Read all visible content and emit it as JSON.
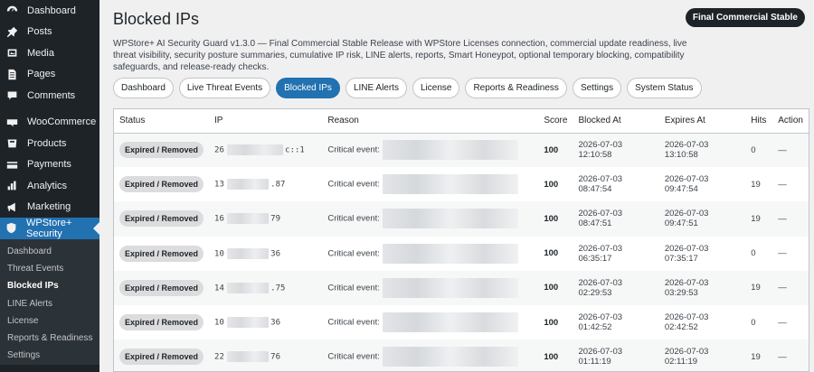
{
  "sidebar": {
    "items": [
      {
        "label": "Dashboard",
        "icon": "dashboard-icon"
      },
      {
        "label": "Posts",
        "icon": "pin-icon"
      },
      {
        "label": "Media",
        "icon": "media-icon"
      },
      {
        "label": "Pages",
        "icon": "pages-icon"
      },
      {
        "label": "Comments",
        "icon": "comments-icon"
      },
      {
        "label": "WooCommerce",
        "icon": "woocommerce-icon"
      },
      {
        "label": "Products",
        "icon": "products-icon"
      },
      {
        "label": "Payments",
        "icon": "payments-icon"
      },
      {
        "label": "Analytics",
        "icon": "analytics-icon"
      },
      {
        "label": "Marketing",
        "icon": "marketing-icon"
      },
      {
        "label": "WPStore+ Security",
        "icon": "shield-icon"
      }
    ],
    "submenu": [
      "Dashboard",
      "Threat Events",
      "Blocked IPs",
      "LINE Alerts",
      "License",
      "Reports & Readiness",
      "Settings"
    ]
  },
  "header": {
    "title": "Blocked IPs",
    "badge": "Final Commercial Stable",
    "description": "WPStore+ AI Security Guard v1.3.0 — Final Commercial Stable Release with WPStore Licenses connection, commercial update readiness, live threat visibility, security posture summaries, cumulative IP risk, LINE alerts, reports, Smart Honeypot, optional temporary blocking, compatibility safeguards, and release-ready checks."
  },
  "tabs": [
    "Dashboard",
    "Live Threat Events",
    "Blocked IPs",
    "LINE Alerts",
    "License",
    "Reports & Readiness",
    "Settings",
    "System Status"
  ],
  "table": {
    "columns": [
      "Status",
      "IP",
      "Reason",
      "Score",
      "Blocked At",
      "Expires At",
      "Hits",
      "Action"
    ],
    "rows": [
      {
        "status": "Expired / Removed",
        "ip_start": "26",
        "ip_end": "c::1",
        "reason": "Critical event:",
        "score": "100",
        "blocked_at": "2026-07-03 12:10:58",
        "expires_at": "2026-07-03 13:10:58",
        "hits": "0",
        "action": "—"
      },
      {
        "status": "Expired / Removed",
        "ip_start": "13",
        "ip_end": ".87",
        "reason": "Critical event:",
        "score": "100",
        "blocked_at": "2026-07-03 08:47:54",
        "expires_at": "2026-07-03 09:47:54",
        "hits": "19",
        "action": "—"
      },
      {
        "status": "Expired / Removed",
        "ip_start": "16",
        "ip_end": "79",
        "reason": "Critical event:",
        "score": "100",
        "blocked_at": "2026-07-03 08:47:51",
        "expires_at": "2026-07-03 09:47:51",
        "hits": "19",
        "action": "—"
      },
      {
        "status": "Expired / Removed",
        "ip_start": "10",
        "ip_end": "36",
        "reason": "Critical event:",
        "score": "100",
        "blocked_at": "2026-07-03 06:35:17",
        "expires_at": "2026-07-03 07:35:17",
        "hits": "0",
        "action": "—"
      },
      {
        "status": "Expired / Removed",
        "ip_start": "14",
        "ip_end": ".75",
        "reason": "Critical event:",
        "score": "100",
        "blocked_at": "2026-07-03 02:29:53",
        "expires_at": "2026-07-03 03:29:53",
        "hits": "19",
        "action": "—"
      },
      {
        "status": "Expired / Removed",
        "ip_start": "10",
        "ip_end": "36",
        "reason": "Critical event:",
        "score": "100",
        "blocked_at": "2026-07-03 01:42:52",
        "expires_at": "2026-07-03 02:42:52",
        "hits": "0",
        "action": "—"
      },
      {
        "status": "Expired / Removed",
        "ip_start": "22",
        "ip_end": "76",
        "reason": "Critical event:",
        "score": "100",
        "blocked_at": "2026-07-03 01:11:19",
        "expires_at": "2026-07-03 02:11:19",
        "hits": "19",
        "action": "—"
      }
    ]
  },
  "colors": {
    "sidebar_bg": "#1d2327",
    "accent": "#2271b1",
    "badge_bg": "#1d2327"
  }
}
